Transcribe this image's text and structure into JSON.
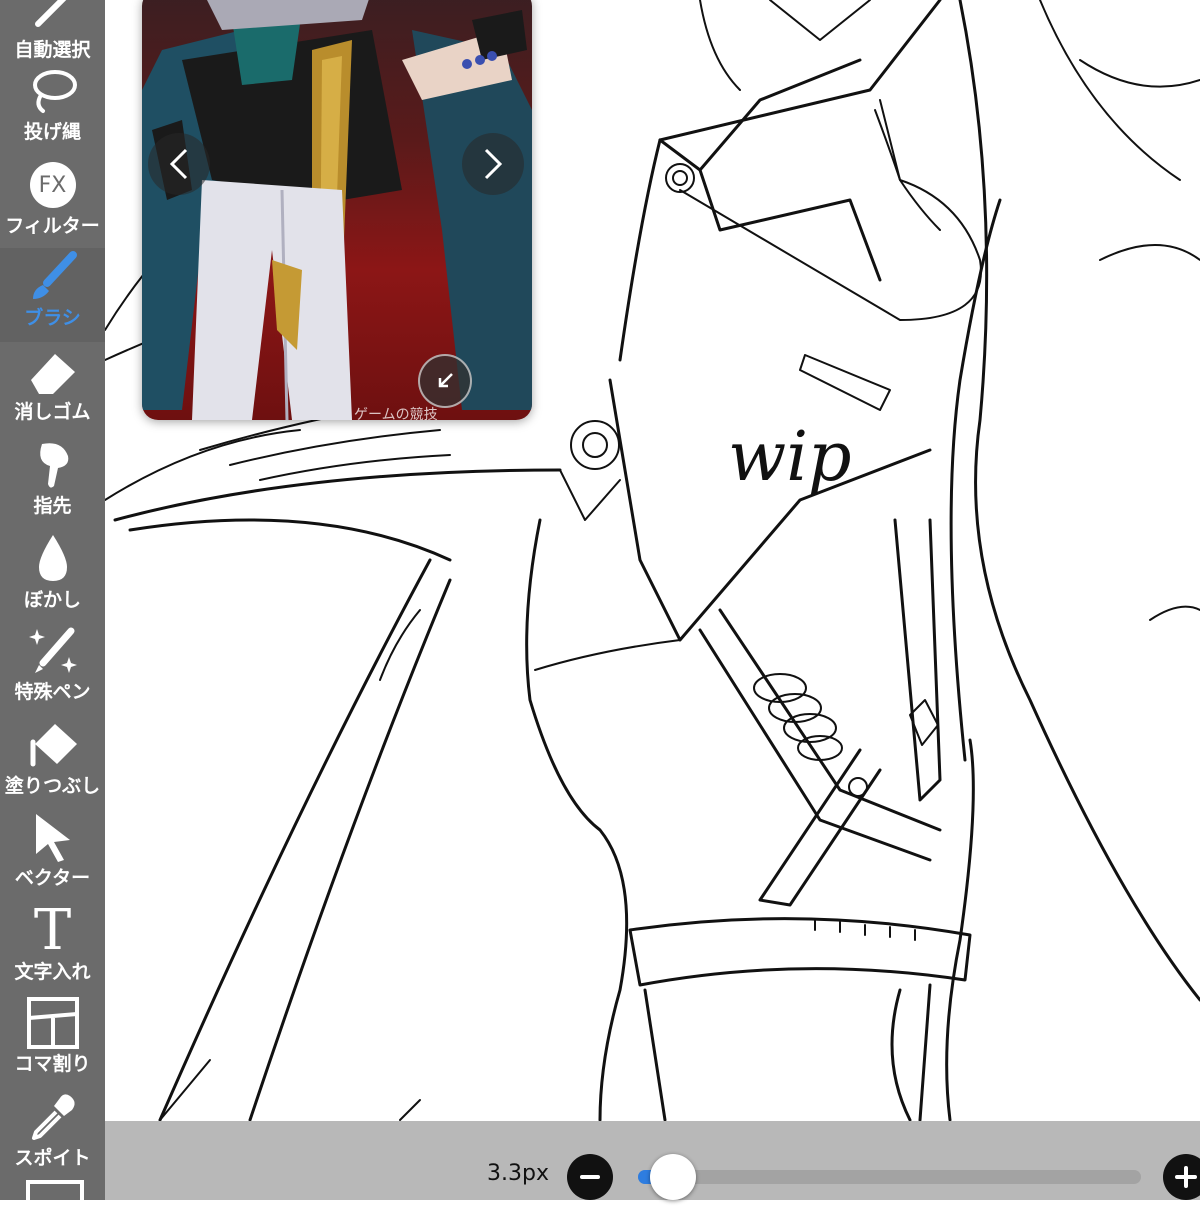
{
  "toolbar": {
    "items": [
      {
        "label": "自動選択",
        "icon": "magic-wand-icon"
      },
      {
        "label": "投げ縄",
        "icon": "lasso-icon"
      },
      {
        "label": "フィルター",
        "icon": "fx-filter-icon"
      },
      {
        "label": "ブラシ",
        "icon": "brush-icon",
        "active": true
      },
      {
        "label": "消しゴム",
        "icon": "eraser-icon"
      },
      {
        "label": "指先",
        "icon": "finger-smudge-icon"
      },
      {
        "label": "ぼかし",
        "icon": "blur-drop-icon"
      },
      {
        "label": "特殊ペン",
        "icon": "special-pen-icon"
      },
      {
        "label": "塗りつぶし",
        "icon": "fill-bucket-icon"
      },
      {
        "label": "ベクター",
        "icon": "vector-cursor-icon"
      },
      {
        "label": "文字入れ",
        "icon": "text-icon"
      },
      {
        "label": "コマ割り",
        "icon": "panel-divide-icon"
      },
      {
        "label": "スポイト",
        "icon": "eyedropper-icon"
      }
    ],
    "fx_text": "FX",
    "text_tool_glyph": "T",
    "active_color": "#3f8fe6"
  },
  "reference": {
    "caption": "ゲームの競技",
    "prev_glyph": "‹",
    "next_glyph": "›"
  },
  "canvas": {
    "annotation": "wip"
  },
  "brush_size": {
    "value_label": "3.3px",
    "fraction": 0.07,
    "minus_glyph": "−",
    "plus_glyph": "+",
    "accent": "#2e7de0"
  }
}
